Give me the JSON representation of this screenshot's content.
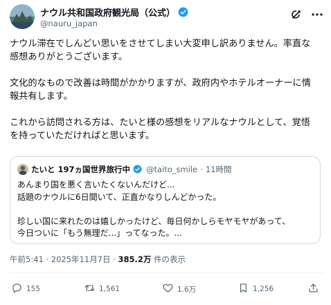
{
  "post": {
    "display_name": "ナウル共和国政府観光局（公式）",
    "handle": "@nauru_japan",
    "paragraphs": [
      "ナウル滞在でしんどい思いをさせてしまい大変申し訳ありません。率直な\n感想ありがとうございます。",
      "文化的なもので改善は時間がかかりますが、政府内やホテルオーナーに情\n報共有します。",
      "これから訪問される方は、たいと様の感想をリアルなナウルとして、覚悟\nを持っていただければと思います。"
    ]
  },
  "quote": {
    "name": "たいと 197ヵ国世界旅行中",
    "handle": "@taito_smile",
    "separator": "·",
    "time": "11時間",
    "paragraphs": [
      "あんまり国を悪く言いたくないんだけど...\n話題のナウルに6日間いて、正直かなりしんどかった。",
      "珍しい国に来れたのは嬉しかったけど、毎日何かしらモヤモヤがあって、\n今日ついに「もう無理だ...」ってなった。..."
    ]
  },
  "meta": {
    "time": "午前5:41 · 2025年11月7日 · ",
    "views": "385.2万",
    "views_label": " 件の表示"
  },
  "actions": {
    "replies": "155",
    "reposts": "1,561",
    "likes": "1.6万",
    "bookmarks": "1,256"
  },
  "icons": {
    "verified": "verified-badge-icon",
    "grok": "grok-icon",
    "more": "more-icon",
    "reply": "reply-icon",
    "repost": "repost-icon",
    "like": "like-icon",
    "bookmark": "bookmark-icon",
    "share": "share-icon"
  },
  "colors": {
    "verified": "#1d9bf0",
    "text": "#0f1419",
    "secondary": "#536471",
    "border": "#cfd9de"
  }
}
